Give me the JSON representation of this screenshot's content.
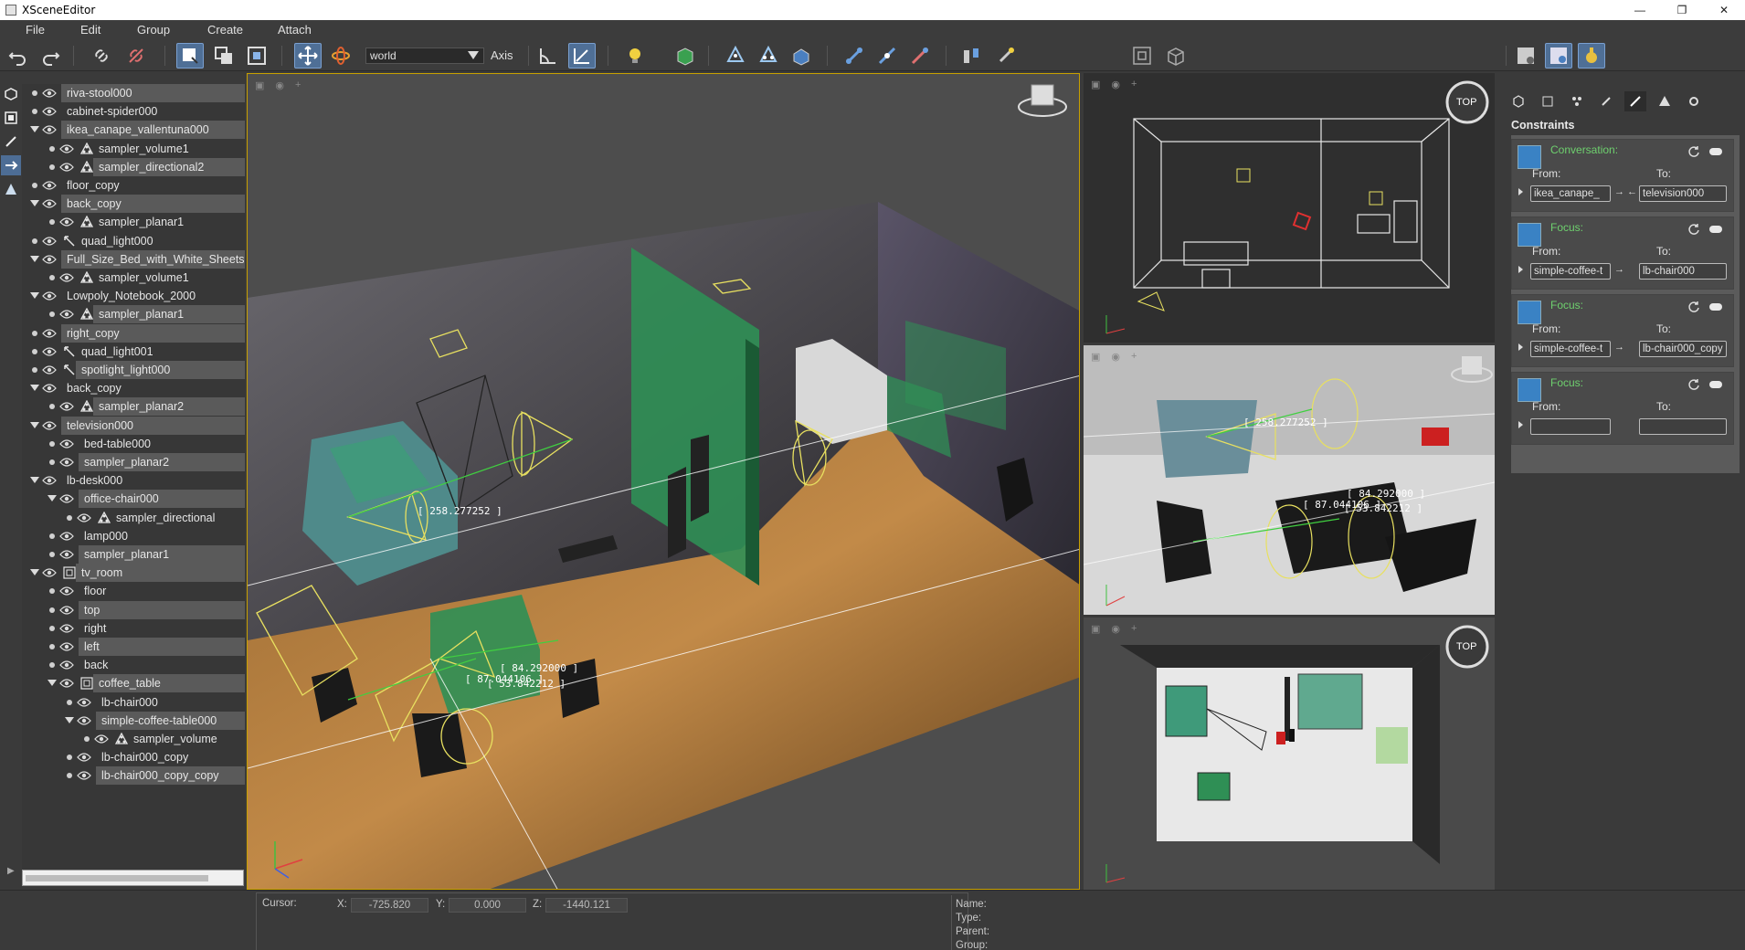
{
  "window": {
    "title": "XSceneEditor",
    "controls": [
      "—",
      "❐",
      "✕"
    ]
  },
  "menu": [
    "File",
    "Edit",
    "Group",
    "Create",
    "Attach"
  ],
  "toolbar": {
    "space_select_value": "world",
    "axis_label": "Axis"
  },
  "tree": [
    {
      "label": "riva-stool000",
      "depth": 0,
      "hl": true,
      "twisty": false,
      "icon": ""
    },
    {
      "label": "cabinet-spider000",
      "depth": 0,
      "hl": false,
      "twisty": false,
      "icon": ""
    },
    {
      "label": "ikea_canape_vallentuna000",
      "depth": 0,
      "hl": true,
      "twisty": true,
      "icon": ""
    },
    {
      "label": "sampler_volume1",
      "depth": 1,
      "hl": false,
      "twisty": false,
      "icon": "sampler"
    },
    {
      "label": "sampler_directional2",
      "depth": 1,
      "hl": true,
      "twisty": false,
      "icon": "sampler"
    },
    {
      "label": "floor_copy",
      "depth": 0,
      "hl": false,
      "twisty": false,
      "icon": ""
    },
    {
      "label": "back_copy",
      "depth": 0,
      "hl": true,
      "twisty": true,
      "icon": ""
    },
    {
      "label": "sampler_planar1",
      "depth": 1,
      "hl": false,
      "twisty": false,
      "icon": "sampler"
    },
    {
      "label": "quad_light000",
      "depth": 0,
      "hl": false,
      "twisty": false,
      "icon": "light"
    },
    {
      "label": "Full_Size_Bed_with_White_Sheets",
      "depth": 0,
      "hl": true,
      "twisty": true,
      "icon": ""
    },
    {
      "label": "sampler_volume1",
      "depth": 1,
      "hl": false,
      "twisty": false,
      "icon": "sampler"
    },
    {
      "label": "Lowpoly_Notebook_2000",
      "depth": 0,
      "hl": false,
      "twisty": true,
      "icon": ""
    },
    {
      "label": "sampler_planar1",
      "depth": 1,
      "hl": true,
      "twisty": false,
      "icon": "sampler"
    },
    {
      "label": "right_copy",
      "depth": 0,
      "hl": true,
      "twisty": false,
      "icon": ""
    },
    {
      "label": "quad_light001",
      "depth": 0,
      "hl": false,
      "twisty": false,
      "icon": "light"
    },
    {
      "label": "spotlight_light000",
      "depth": 0,
      "hl": true,
      "twisty": false,
      "icon": "light"
    },
    {
      "label": "back_copy",
      "depth": 0,
      "hl": false,
      "twisty": true,
      "icon": ""
    },
    {
      "label": "sampler_planar2",
      "depth": 1,
      "hl": true,
      "twisty": false,
      "icon": "sampler"
    },
    {
      "label": "television000",
      "depth": 0,
      "hl": true,
      "twisty": true,
      "icon": ""
    },
    {
      "label": "bed-table000",
      "depth": 1,
      "hl": false,
      "twisty": false,
      "icon": ""
    },
    {
      "label": "sampler_planar2",
      "depth": 1,
      "hl": true,
      "twisty": false,
      "icon": ""
    },
    {
      "label": "lb-desk000",
      "depth": 0,
      "hl": false,
      "twisty": true,
      "icon": ""
    },
    {
      "label": "office-chair000",
      "depth": 1,
      "hl": true,
      "twisty": true,
      "icon": ""
    },
    {
      "label": "sampler_directional",
      "depth": 2,
      "hl": false,
      "twisty": false,
      "icon": "sampler"
    },
    {
      "label": "lamp000",
      "depth": 1,
      "hl": false,
      "twisty": false,
      "icon": ""
    },
    {
      "label": "sampler_planar1",
      "depth": 1,
      "hl": true,
      "twisty": false,
      "icon": ""
    },
    {
      "label": "tv_room",
      "depth": 0,
      "hl": true,
      "twisty": true,
      "icon": "group"
    },
    {
      "label": "floor",
      "depth": 1,
      "hl": false,
      "twisty": false,
      "icon": ""
    },
    {
      "label": "top",
      "depth": 1,
      "hl": true,
      "twisty": false,
      "icon": ""
    },
    {
      "label": "right",
      "depth": 1,
      "hl": false,
      "twisty": false,
      "icon": ""
    },
    {
      "label": "left",
      "depth": 1,
      "hl": true,
      "twisty": false,
      "icon": ""
    },
    {
      "label": "back",
      "depth": 1,
      "hl": false,
      "twisty": false,
      "icon": ""
    },
    {
      "label": "coffee_table",
      "depth": 1,
      "hl": true,
      "twisty": true,
      "icon": "group"
    },
    {
      "label": "lb-chair000",
      "depth": 2,
      "hl": false,
      "twisty": false,
      "icon": ""
    },
    {
      "label": "simple-coffee-table000",
      "depth": 2,
      "hl": true,
      "twisty": true,
      "icon": ""
    },
    {
      "label": "sampler_volume",
      "depth": 3,
      "hl": false,
      "twisty": false,
      "icon": "sampler"
    },
    {
      "label": "lb-chair000_copy",
      "depth": 2,
      "hl": false,
      "twisty": false,
      "icon": ""
    },
    {
      "label": "lb-chair000_copy_copy",
      "depth": 2,
      "hl": true,
      "twisty": false,
      "icon": ""
    }
  ],
  "viewports": {
    "main": {
      "tags": [
        "[ 258.277252 ]",
        "[ 87.044106 ]",
        "[ 84.292000 ]",
        "[ 53.842212 ]"
      ]
    },
    "top_right": {
      "nav": "TOP"
    },
    "mid_right": {
      "tags": [
        "[ 258.277252 ]",
        "[ 87.044106 ]",
        "[ 84.292000 ]",
        "[ 53.842212 ]"
      ]
    },
    "bottom_right": {
      "nav": "TOP"
    }
  },
  "constraints": {
    "title": "Constraints",
    "from_label": "From:",
    "to_label": "To:",
    "items": [
      {
        "type": "Conversation:",
        "from": "ikea_canape_",
        "to": "television000",
        "arrow": "→ ←"
      },
      {
        "type": "Focus:",
        "from": "simple-coffee-t",
        "to": "lb-chair000",
        "arrow": "→"
      },
      {
        "type": "Focus:",
        "from": "simple-coffee-t",
        "to": "lb-chair000_copy",
        "arrow": "→"
      },
      {
        "type": "Focus:",
        "from": "",
        "to": "",
        "arrow": ""
      }
    ]
  },
  "status": {
    "cursor_label": "Cursor:",
    "x_label": "X:",
    "x_value": "-725.820",
    "y_label": "Y:",
    "y_value": "0.000",
    "z_label": "Z:",
    "z_value": "-1440.121",
    "name_label": "Name:",
    "type_label": "Type:",
    "parent_label": "Parent:",
    "group_label": "Group:"
  },
  "colors": {
    "accent": "#4f6f96",
    "constraint_title": "#6ed06e",
    "viewport_border": "#c8a000"
  }
}
